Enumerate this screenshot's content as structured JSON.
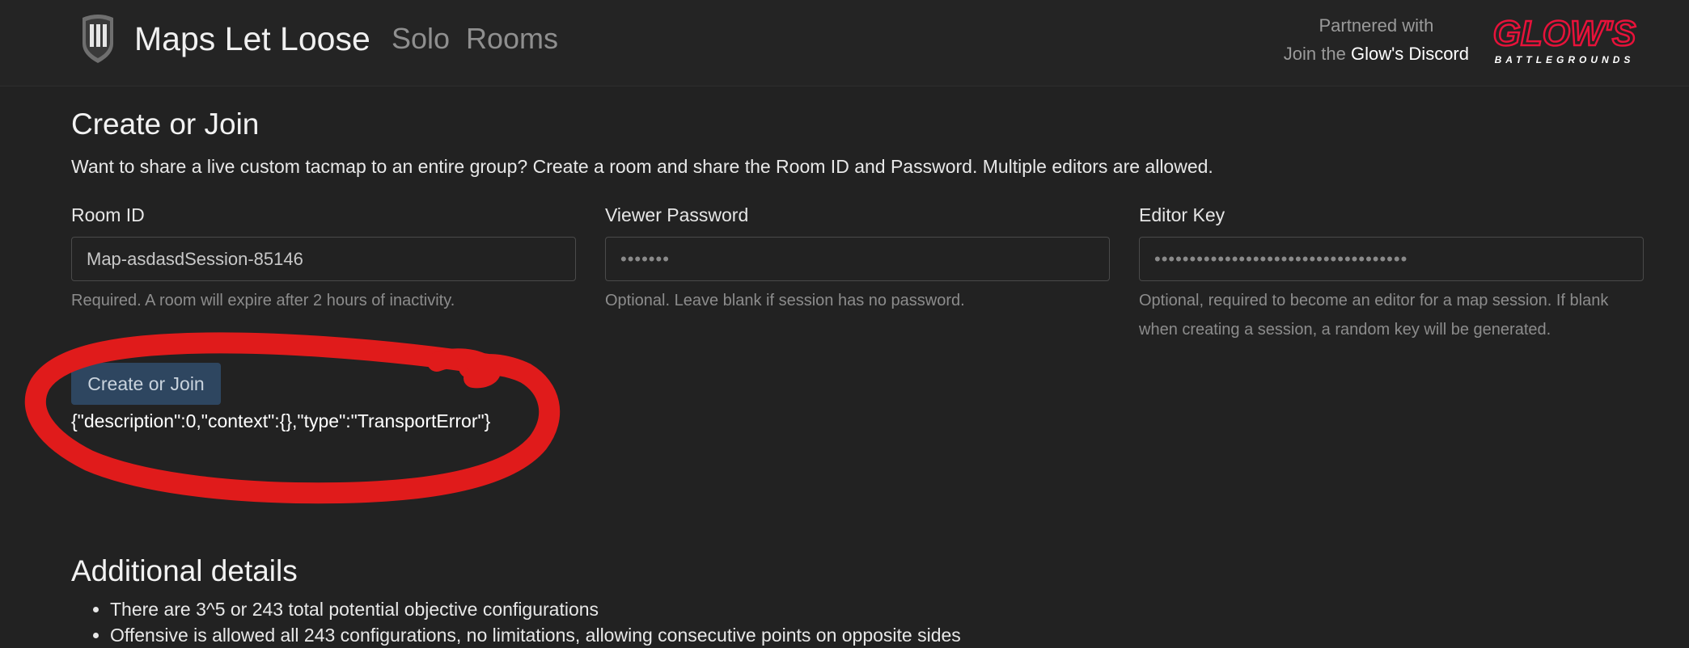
{
  "header": {
    "brand": "Maps Let Loose",
    "nav": [
      "Solo",
      "Rooms"
    ],
    "partner_line": "Partnered with",
    "join_prefix": "Join the",
    "discord_link": "Glow's Discord",
    "partner_logo_main": "GLOW'S",
    "partner_logo_sub": "BATTLEGROUNDS"
  },
  "create": {
    "title": "Create or Join",
    "intro": "Want to share a live custom tacmap to an entire group? Create a room and share the Room ID and Password. Multiple editors are allowed.",
    "room_id": {
      "label": "Room ID",
      "value": "Map-asdasdSession-85146",
      "help": "Required. A room will expire after 2 hours of inactivity."
    },
    "viewer_password": {
      "label": "Viewer Password",
      "value": "•••••••",
      "help": "Optional. Leave blank if session has no password."
    },
    "editor_key": {
      "label": "Editor Key",
      "value": "••••••••••••••••••••••••••••••••••••",
      "help": "Optional, required to become an editor for a map session. If blank when creating a session, a random key will be generated."
    },
    "button_label": "Create or Join",
    "error": "{\"description\":0,\"context\":{},\"type\":\"TransportError\"}"
  },
  "details": {
    "title": "Additional details",
    "items": [
      "There are 3^5 or 243 total potential objective configurations",
      "Offensive is allowed all 243 configurations, no limitations, allowing consecutive points on opposite sides"
    ]
  },
  "colors": {
    "background": "#222222",
    "button": "#2e4660",
    "annotation": "#e01b1b",
    "partner_accent": "#e8123a"
  },
  "icons": {
    "logo": "helmet-logo-icon",
    "partner": "glows-battlegrounds-logo"
  }
}
